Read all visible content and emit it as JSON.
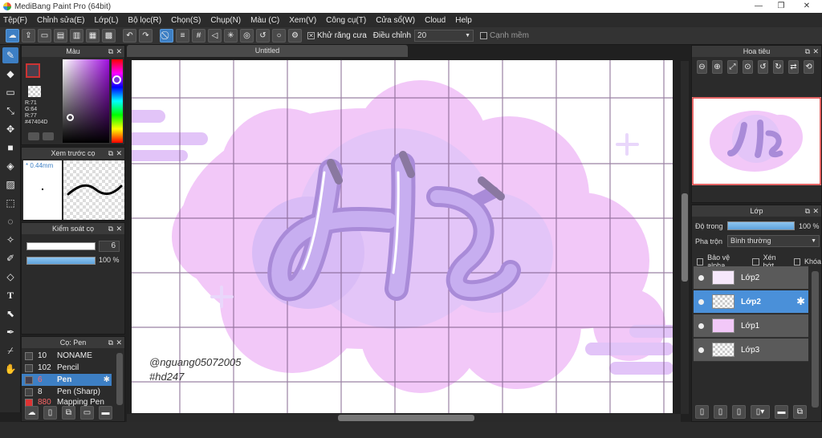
{
  "window": {
    "title": "MediBang Paint Pro (64bit)"
  },
  "menu": [
    "Tệp(F)",
    "Chỉnh sửa(E)",
    "Lớp(L)",
    "Bộ lọc(R)",
    "Chọn(S)",
    "Chụp(N)",
    "Màu (C)",
    "Xem(V)",
    "Công cụ(T)",
    "Cửa sổ(W)",
    "Cloud",
    "Help"
  ],
  "toolbar": {
    "antialias_label": "Khử răng cưa",
    "adjust_label": "Điều chỉnh",
    "adjust_value": "20",
    "edge_label": "Cạnh mềm"
  },
  "color_panel": {
    "title": "Màu",
    "r": "R:71",
    "g": "G:64",
    "b": "R:77",
    "hex": "#47404D",
    "primary_color": "#47404D"
  },
  "preview_panel": {
    "title": "Xem trước cọ",
    "size": "0.44mm"
  },
  "brush_control": {
    "title": "Kiểm soát cọ",
    "size": "6",
    "opacity": "100 %"
  },
  "brush_list": {
    "title": "Cọ: Pen",
    "items": [
      {
        "size": "10",
        "name": "NONAME"
      },
      {
        "size": "102",
        "name": "Pencil"
      },
      {
        "size": "6",
        "name": "Pen"
      },
      {
        "size": "8",
        "name": "Pen (Sharp)"
      },
      {
        "size": "880",
        "name": "Mapping Pen"
      }
    ]
  },
  "canvas": {
    "tab": "Untitled",
    "artwork_title": "Hé",
    "watermark_line1": "@nguang05072005",
    "watermark_line2": "#hd247"
  },
  "navigator": {
    "title": "Hoa tiêu"
  },
  "layer_panel": {
    "title": "Lớp",
    "opacity_label": "Độ trong",
    "opacity_value": "100 %",
    "blend_label": "Pha trộn",
    "blend_value": "Bình thường",
    "protect_alpha": "Bảo vệ alpha",
    "clip": "Xén bớt",
    "lock": "Khóa",
    "layers": [
      "Lớp2",
      "Lớp2",
      "Lớp1",
      "Lớp3"
    ]
  },
  "colors": {
    "accent": "#3d7fc4",
    "pink": "#f0c6f5",
    "purple": "#c9a7f2"
  }
}
